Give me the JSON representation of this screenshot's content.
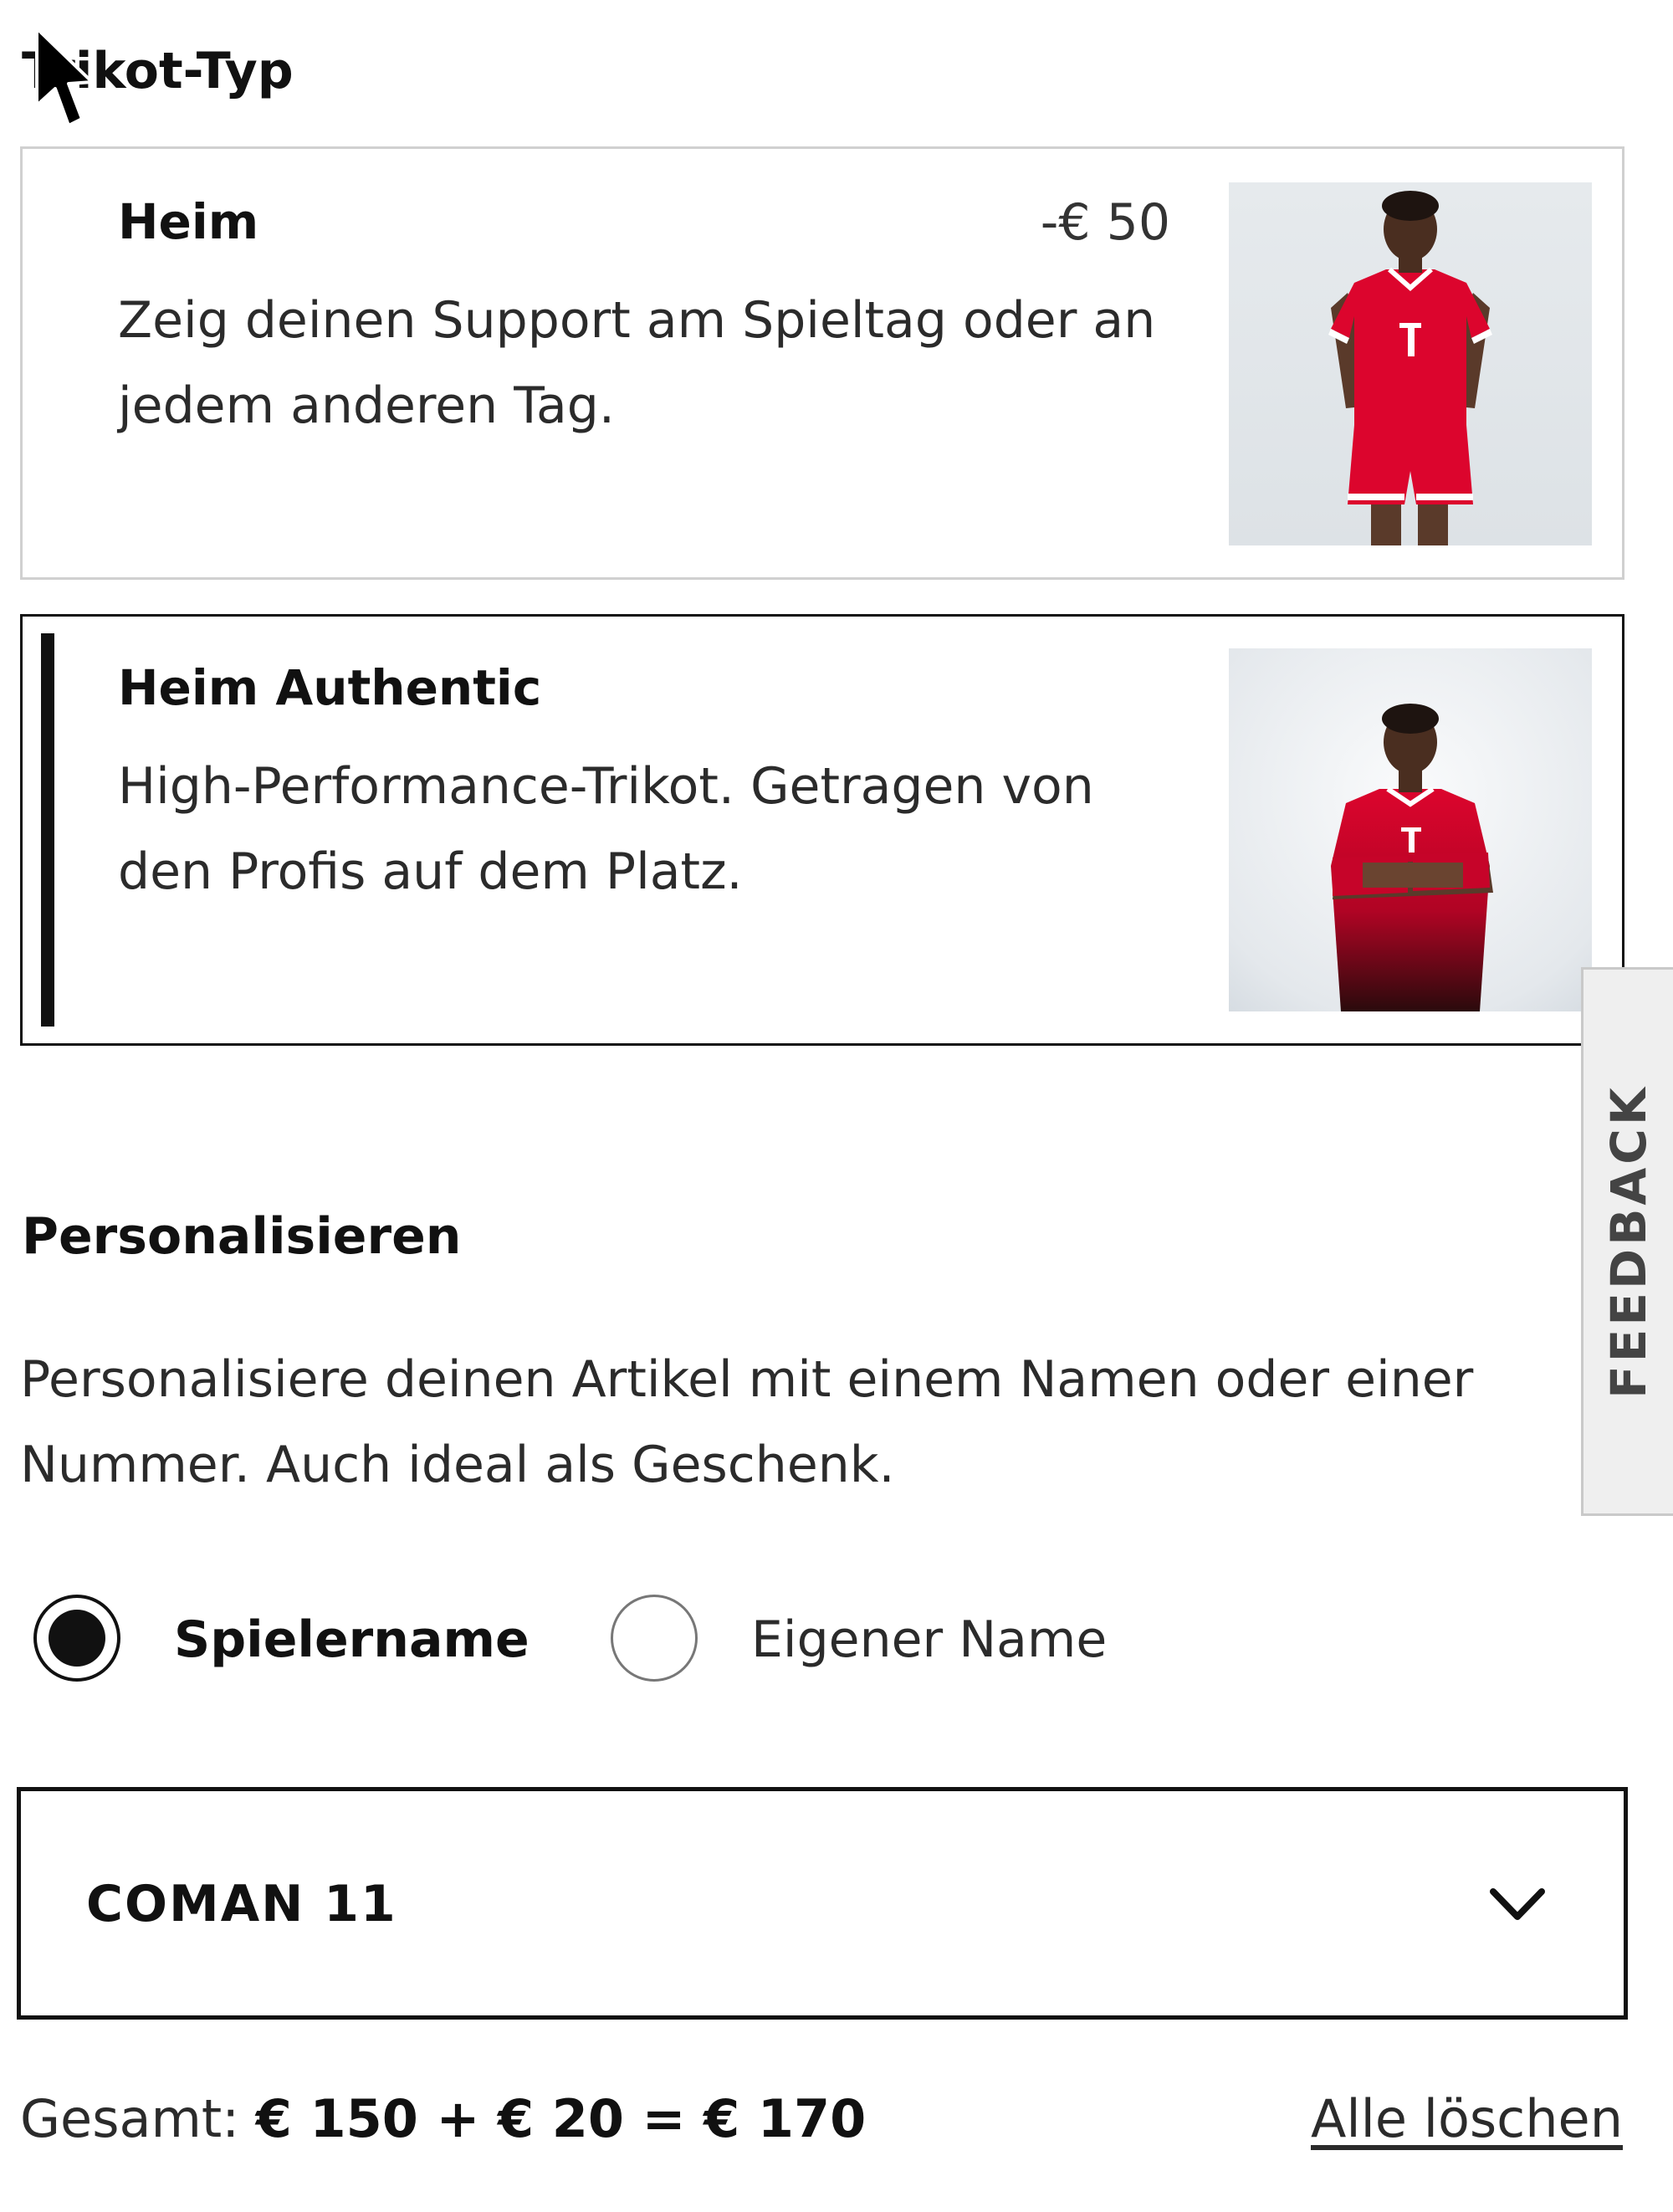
{
  "jersey_type": {
    "title": "Trikot-Typ",
    "options": [
      {
        "name": "Heim",
        "price_delta": "-€ 50",
        "description": "Zeig deinen Support am Spieltag oder an jedem anderen Tag.",
        "selected": false,
        "image_icon": "player-home-jersey"
      },
      {
        "name": "Heim Authentic",
        "price_delta": "",
        "description": "High-Performance-Trikot. Getragen von den Profis auf dem Platz.",
        "selected": true,
        "image_icon": "player-authentic-jersey"
      }
    ]
  },
  "personalize": {
    "title": "Personalisieren",
    "intro_line1": "Personalisiere deinen Artikel mit einem Namen oder einer",
    "intro_line2": "Nummer. Auch ideal als Geschenk.",
    "radio_options": [
      {
        "label": "Spielername",
        "checked": true
      },
      {
        "label": "Eigener Name",
        "checked": false
      }
    ],
    "player_select": {
      "value": "COMAN 11",
      "icon": "chevron-down-icon"
    }
  },
  "summary": {
    "total_label": "Gesamt:",
    "total_calc": "€ 150 + € 20 = € 170",
    "clear_label": "Alle löschen"
  },
  "feedback_tab": {
    "label": "FEEDBACK"
  },
  "colors": {
    "primary": "#111111",
    "card_border": "#d0d0d0",
    "jersey_red": "#dc052d",
    "feedback_bg": "#efefef"
  }
}
